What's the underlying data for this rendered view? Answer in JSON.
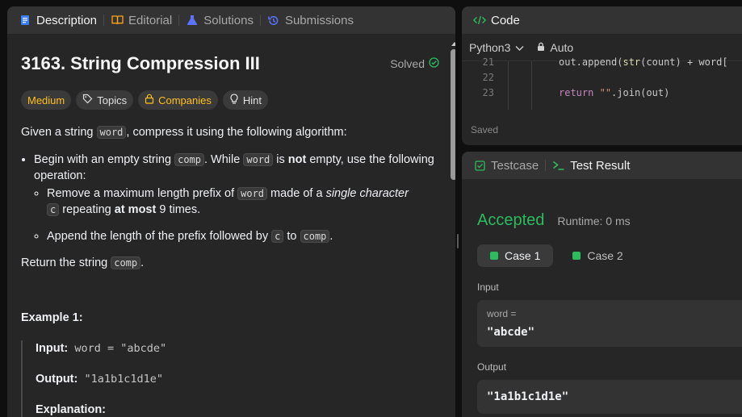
{
  "left_tabs": [
    {
      "label": "Description",
      "icon": "description-icon"
    },
    {
      "label": "Editorial",
      "icon": "book-icon"
    },
    {
      "label": "Solutions",
      "icon": "flask-icon"
    },
    {
      "label": "Submissions",
      "icon": "history-icon"
    }
  ],
  "problem": {
    "title": "3163. String Compression III",
    "solved_label": "Solved",
    "difficulty": "Medium",
    "topics_label": "Topics",
    "companies_label": "Companies",
    "hint_label": "Hint",
    "intro_a": "Given a string ",
    "intro_code": "word",
    "intro_b": ", compress it using the following algorithm:",
    "b1_a": "Begin with an empty string ",
    "b1_code1": "comp",
    "b1_b": ". While ",
    "b1_code2": "word",
    "b1_c": " is ",
    "b1_bold": "not",
    "b1_d": " empty, use the following operation:",
    "b2_a": "Remove a maximum length prefix of ",
    "b2_code1": "word",
    "b2_b": " made of a ",
    "b2_italic": "single character",
    "b2_code2": "c",
    "b2_c": " repeating ",
    "b2_bold": "at most",
    "b2_d": " 9 times.",
    "b3_a": "Append the length of the prefix followed by ",
    "b3_code1": "c",
    "b3_b": " to ",
    "b3_code2": "comp",
    "b3_c": ".",
    "ret_a": "Return the string ",
    "ret_code": "comp",
    "ret_b": ".",
    "example_title": "Example 1:",
    "ex_input_label": "Input:",
    "ex_input_value": " word = \"abcde\"",
    "ex_output_label": "Output:",
    "ex_output_value": " \"1a1b1c1d1e\"",
    "ex_expl_label": "Explanation:"
  },
  "code_panel": {
    "title": "Code",
    "language": "Python3",
    "mode": "Auto",
    "lines": [
      {
        "num": "21",
        "text": "out.append(str(count) + word["
      },
      {
        "num": "22",
        "text": ""
      },
      {
        "num": "23",
        "text": "return \"\".join(out)"
      }
    ],
    "status": "Saved"
  },
  "test_panel": {
    "tab_testcase": "Testcase",
    "tab_result": "Test Result",
    "status": "Accepted",
    "runtime": "Runtime: 0 ms",
    "cases": [
      "Case 1",
      "Case 2"
    ],
    "input_label": "Input",
    "input_var": "word =",
    "input_value": "\"abcde\"",
    "output_label": "Output",
    "output_value": "\"1a1b1c1d1e\""
  },
  "colors": {
    "accent_green": "#2cbb5d",
    "difficulty_medium": "#ffc01e",
    "panel_bg": "#262626"
  }
}
